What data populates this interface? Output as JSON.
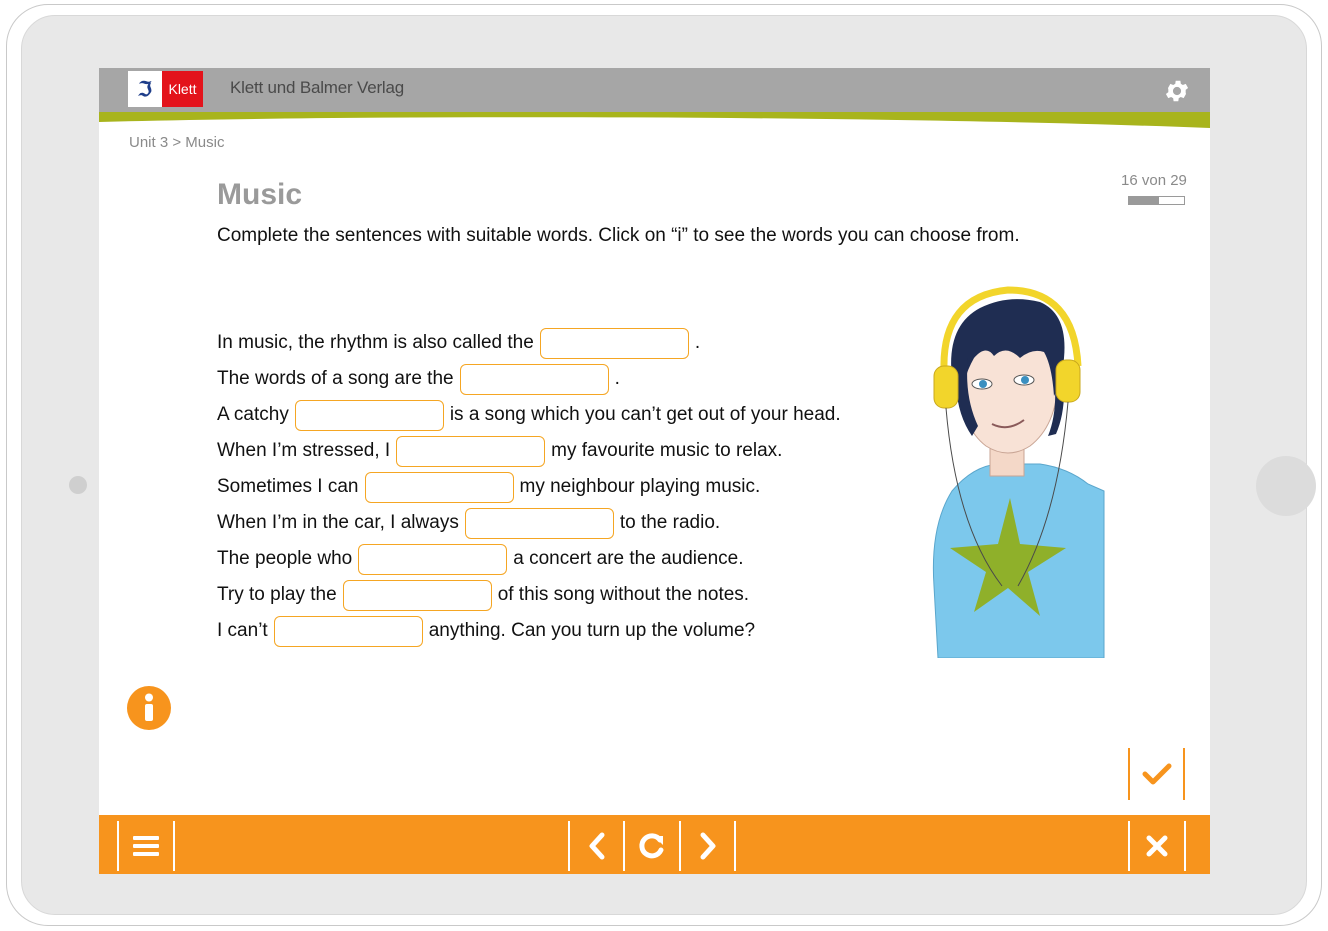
{
  "app": {
    "publisher": "Klett und Balmer Verlag",
    "logo_text": "Klett",
    "logo_mark": "ℑ"
  },
  "breadcrumb": "Unit 3 > Music",
  "exercise": {
    "title": "Music",
    "page_counter": "16 von 29",
    "progress_fraction": 0.55,
    "instruction": "Complete the sentences with suitable words. Click on “i” to see the words you can choose from.",
    "sentences": [
      {
        "before": "In music, the rhythm is also called the",
        "after": "."
      },
      {
        "before": "The words of a song are the",
        "after": "."
      },
      {
        "before": "A catchy",
        "after": "is a song which you can’t get out of your head."
      },
      {
        "before": "When I’m stressed, I",
        "after": "my favourite music to relax."
      },
      {
        "before": "Sometimes I can",
        "after": "my neighbour playing music."
      },
      {
        "before": "When I’m in the car, I always",
        "after": "to the radio."
      },
      {
        "before": "The people who",
        "after": "a concert are the audience."
      },
      {
        "before": "Try to play the",
        "after": "of this song without the notes."
      },
      {
        "before": "I can’t",
        "after": "anything. Can you turn up the volume?"
      }
    ],
    "blank_value": ""
  },
  "icons": {
    "settings": "gear-icon",
    "info": "info-icon",
    "check": "check-icon",
    "menu": "menu-icon",
    "prev": "chevron-left-icon",
    "reload": "reload-icon",
    "next": "chevron-right-icon",
    "close": "close-icon"
  },
  "colors": {
    "accent_orange": "#f7941d",
    "header_gray": "#a6a6a6",
    "band_green": "#a8b41c",
    "logo_red": "#e3131b",
    "title_gray": "#9a9a9a"
  }
}
